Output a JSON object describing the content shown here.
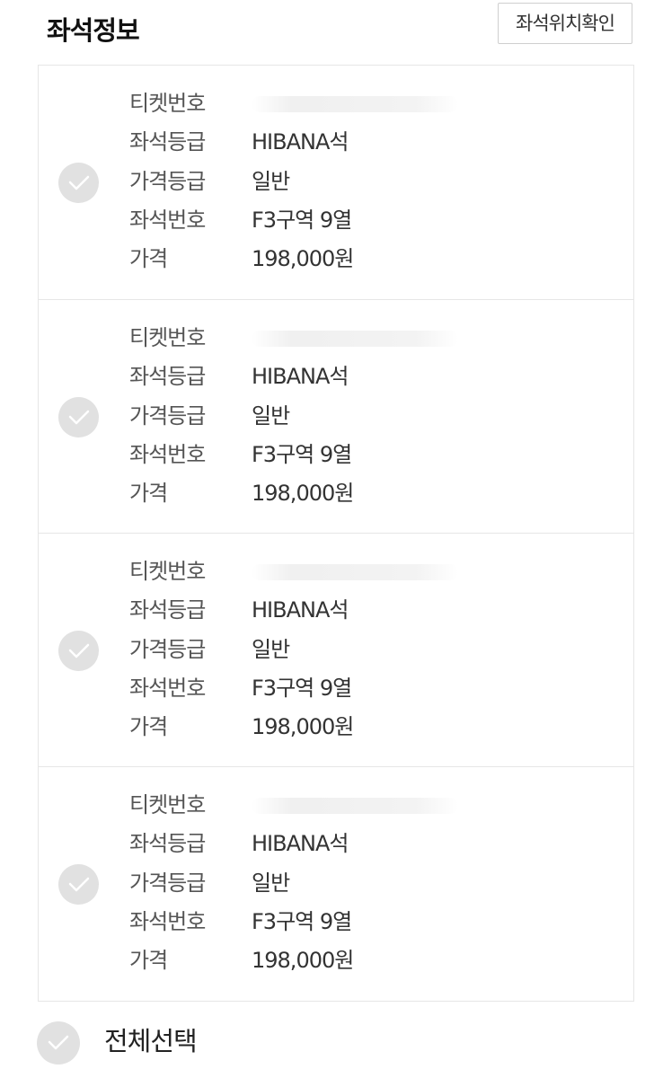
{
  "header": {
    "title": "좌석정보",
    "seat_location_button": "좌석위치확인"
  },
  "tickets": [
    {
      "selected": false,
      "ticket_no_label": "티켓번호",
      "ticket_no": "",
      "seat_grade_label": "좌석등급",
      "seat_grade": "HIBANA석",
      "price_grade_label": "가격등급",
      "price_grade": "일반",
      "seat_no_label": "좌석번호",
      "seat_no": "F3구역 9열",
      "price_label": "가격",
      "price": "198,000원"
    },
    {
      "selected": false,
      "ticket_no_label": "티켓번호",
      "ticket_no": "",
      "seat_grade_label": "좌석등급",
      "seat_grade": "HIBANA석",
      "price_grade_label": "가격등급",
      "price_grade": "일반",
      "seat_no_label": "좌석번호",
      "seat_no": "F3구역 9열",
      "price_label": "가격",
      "price": "198,000원"
    },
    {
      "selected": false,
      "ticket_no_label": "티켓번호",
      "ticket_no": "",
      "seat_grade_label": "좌석등급",
      "seat_grade": "HIBANA석",
      "price_grade_label": "가격등급",
      "price_grade": "일반",
      "seat_no_label": "좌석번호",
      "seat_no": "F3구역 9열",
      "price_label": "가격",
      "price": "198,000원"
    },
    {
      "selected": false,
      "ticket_no_label": "티켓번호",
      "ticket_no": "",
      "seat_grade_label": "좌석등급",
      "seat_grade": "HIBANA석",
      "price_grade_label": "가격등급",
      "price_grade": "일반",
      "seat_no_label": "좌석번호",
      "seat_no": "F3구역 9열",
      "price_label": "가격",
      "price": "198,000원"
    }
  ],
  "footer": {
    "select_all_label": "전체선택",
    "select_all_checked": false
  },
  "colors": {
    "check_circle": "#e1e1e1",
    "border": "#e6e6e6",
    "text": "#333333"
  }
}
